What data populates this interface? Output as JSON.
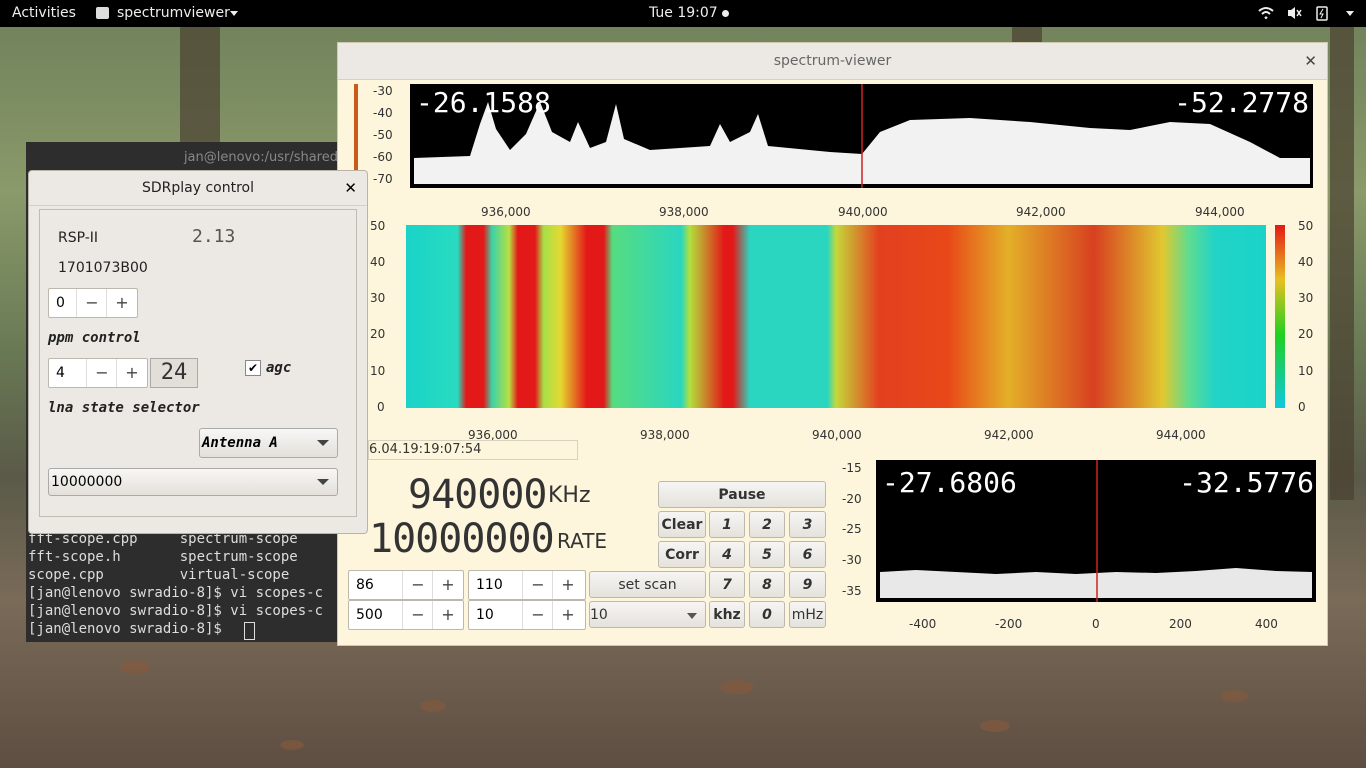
{
  "topbar": {
    "activities": "Activities",
    "app_name": "spectrumviewer",
    "clock": "Tue 19:07"
  },
  "terminal": {
    "title": "jan@lenovo:/usr/shared",
    "lines": [
      "fft-scope.cpp     spectrum-scope",
      "fft-scope.h       spectrum-scope",
      "scope.cpp         virtual-scope",
      "[jan@lenovo swradio-8]$ vi scopes-c",
      "[jan@lenovo swradio-8]$ vi scopes-c",
      "[jan@lenovo swradio-8]$ "
    ]
  },
  "main_window": {
    "title": "spectrum-viewer",
    "spectrum": {
      "left_value": "-26.1588",
      "right_value": "-52.2778",
      "y_ticks": [
        "-30",
        "-40",
        "-50",
        "-60",
        "-70"
      ],
      "x_ticks": [
        "936,000",
        "938,000",
        "940,000",
        "942,000",
        "944,000"
      ]
    },
    "waterfall": {
      "y_ticks": [
        "50",
        "40",
        "30",
        "20",
        "10",
        "0"
      ],
      "x_ticks": [
        "936,000",
        "938,000",
        "940,000",
        "942,000",
        "944,000"
      ],
      "colorbar_ticks": [
        "50",
        "40",
        "30",
        "20",
        "10",
        "0"
      ],
      "timestamp": "6.04.19:19:07:54"
    },
    "frequency_display": "940000",
    "frequency_unit": "KHz",
    "rate_display": "10000000",
    "rate_label": "RATE",
    "keypad": {
      "pause": "Pause",
      "clear": "Clear",
      "corr": "Corr",
      "set_scan": "set scan",
      "khz": "khz",
      "mhz": "mHz",
      "digits": [
        "1",
        "2",
        "3",
        "4",
        "5",
        "6",
        "7",
        "8",
        "9",
        "0"
      ]
    },
    "spinboxes": [
      {
        "value": "86"
      },
      {
        "value": "110"
      },
      {
        "value": "500"
      },
      {
        "value": "10"
      }
    ],
    "step_select": "10",
    "zoom_spectrum": {
      "left_value": "-27.6806",
      "right_value": "-32.5776",
      "y_ticks": [
        "-15",
        "-20",
        "-25",
        "-30",
        "-35"
      ],
      "x_ticks": [
        "-400",
        "-200",
        "0",
        "200",
        "400"
      ]
    }
  },
  "sdrplay": {
    "title": "SDRplay control",
    "device": "RSP-II",
    "version": "2.13",
    "serial": "1701073B00",
    "ppm_value": "0",
    "ppm_label": "ppm control",
    "lna_value": "4",
    "gain_display": "24",
    "agc_label": "agc",
    "agc_checked": true,
    "lna_label": "lna state selector",
    "antenna": "Antenna A",
    "rate_select": "10000000"
  },
  "colors": {
    "window_bg": "#fdf6dc",
    "plot_bg": "#000000",
    "marker": "#cc2222"
  }
}
